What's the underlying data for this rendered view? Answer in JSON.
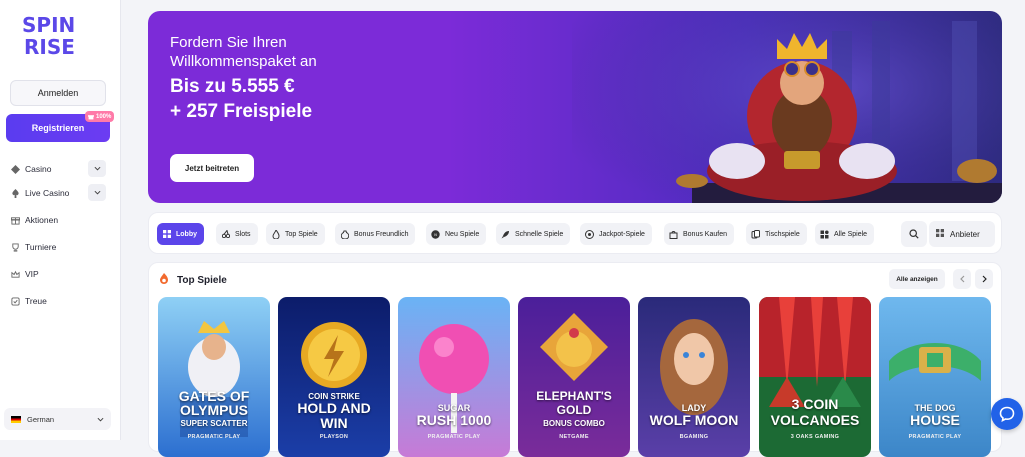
{
  "brand": {
    "line1": "SPIN",
    "line2": "RISE"
  },
  "auth": {
    "login_label": "Anmelden",
    "register_label": "Registrieren",
    "bonus_badge": "100%"
  },
  "nav": [
    {
      "label": "Casino",
      "icon": "casino-icon",
      "expandable": true
    },
    {
      "label": "Live Casino",
      "icon": "live-casino-icon",
      "expandable": true
    },
    {
      "label": "Aktionen",
      "icon": "gift-icon",
      "expandable": false
    },
    {
      "label": "Turniere",
      "icon": "trophy-icon",
      "expandable": false
    },
    {
      "label": "VIP",
      "icon": "crown-icon",
      "expandable": false
    },
    {
      "label": "Treue",
      "icon": "loyalty-icon",
      "expandable": false
    }
  ],
  "language": {
    "label": "German"
  },
  "banner": {
    "line1": "Fordern Sie Ihren",
    "line2": "Willkommenspaket an",
    "highlight1": "Bis zu 5.555 €",
    "highlight2": "+ 257 Freispiele",
    "cta": "Jetzt beitreten"
  },
  "tabs": [
    {
      "label": "Lobby",
      "icon": "grid-icon",
      "active": true
    },
    {
      "label": "Slots",
      "icon": "cherry-icon",
      "active": false
    },
    {
      "label": "Top Spiele",
      "icon": "fire-icon",
      "active": false
    },
    {
      "label": "Bonus Freundlich",
      "icon": "money-bag-icon",
      "active": false
    },
    {
      "label": "Neu Spiele",
      "icon": "new-icon",
      "active": false
    },
    {
      "label": "Schnelle Spiele",
      "icon": "rocket-icon",
      "active": false
    },
    {
      "label": "Jackpot-Spiele",
      "icon": "jackpot-icon",
      "active": false
    },
    {
      "label": "Bonus Kaufen",
      "icon": "shop-icon",
      "active": false
    },
    {
      "label": "Tischspiele",
      "icon": "table-icon",
      "active": false
    },
    {
      "label": "Alle Spiele",
      "icon": "all-games-icon",
      "active": false
    }
  ],
  "providers_label": "Anbieter",
  "section": {
    "title": "Top Spiele",
    "view_all": "Alle anzeigen"
  },
  "games": [
    {
      "name1": "GATES OF",
      "name2": "OLYMPUS",
      "sub": "SUPER SCATTER",
      "provider": "PRAGMATIC PLAY",
      "color": "#3d8be0"
    },
    {
      "name1": "COIN STRIKE",
      "name2": "HOLD AND",
      "sub": "WIN",
      "provider": "PLAYSON",
      "color": "#1a2a8a"
    },
    {
      "name1": "",
      "name2": "SUGAR",
      "sub": "RUSH 1000",
      "provider": "PRAGMATIC PLAY",
      "color": "#62a8f0"
    },
    {
      "name1": "ELEPHANT'S",
      "name2": "GOLD",
      "sub": "BONUS COMBO",
      "provider": "NETGAME",
      "color": "#6a2fb0"
    },
    {
      "name1": "LADY",
      "name2": "WOLF MOON",
      "sub": "",
      "provider": "BGAMING",
      "color": "#3b2f8e"
    },
    {
      "name1": "3 COIN",
      "name2": "VOLCANOES",
      "sub": "",
      "provider": "3 OAKS GAMING",
      "color": "#1f7a3a"
    },
    {
      "name1": "THE DOG",
      "name2": "HOUSE",
      "sub": "",
      "provider": "PRAGMATIC PLAY",
      "color": "#4a9ad8"
    }
  ]
}
